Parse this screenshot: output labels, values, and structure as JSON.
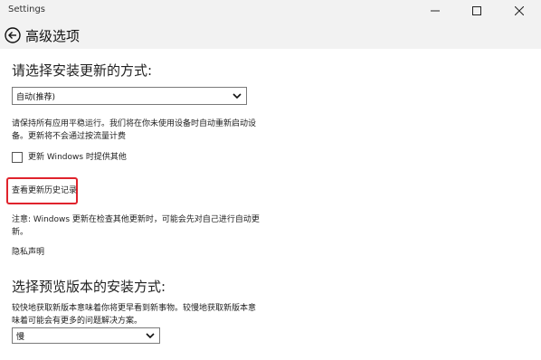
{
  "window": {
    "app_title": "Settings"
  },
  "header": {
    "page_title": "高级选项"
  },
  "update_method": {
    "heading": "请选择安装更新的方式:",
    "selected": "自动(推荐)",
    "description_line1": "请保持所有应用平稳运行。我们将在你未使用设备时自动重新启动设",
    "description_line2": "备。更新将不会通过按流量计费"
  },
  "other_products": {
    "checkbox_label": "更新 Windows 时提供其他",
    "checked": false
  },
  "history": {
    "link_label": "查看更新历史记录"
  },
  "note": {
    "line1": "注意: Windows 更新在检查其他更新时，可能会先对自己进行自动更",
    "line2": "新。"
  },
  "privacy": {
    "link_label": "隐私声明"
  },
  "preview": {
    "heading": "选择预览版本的安装方式:",
    "description_line1": "较快地获取新版本意味着你将更早看到新事物。较慢地获取新版本意",
    "description_line2": "味着可能会有更多的问题解决方案。",
    "selected": "慢"
  },
  "colors": {
    "highlight_border": "#e0232c",
    "titlebar_bg": "#f2f2f2"
  },
  "icons": {
    "back": "back-arrow-icon",
    "minimize": "minimize-icon",
    "maximize": "maximize-icon",
    "close": "close-icon",
    "dropdown": "chevron-down-icon"
  }
}
